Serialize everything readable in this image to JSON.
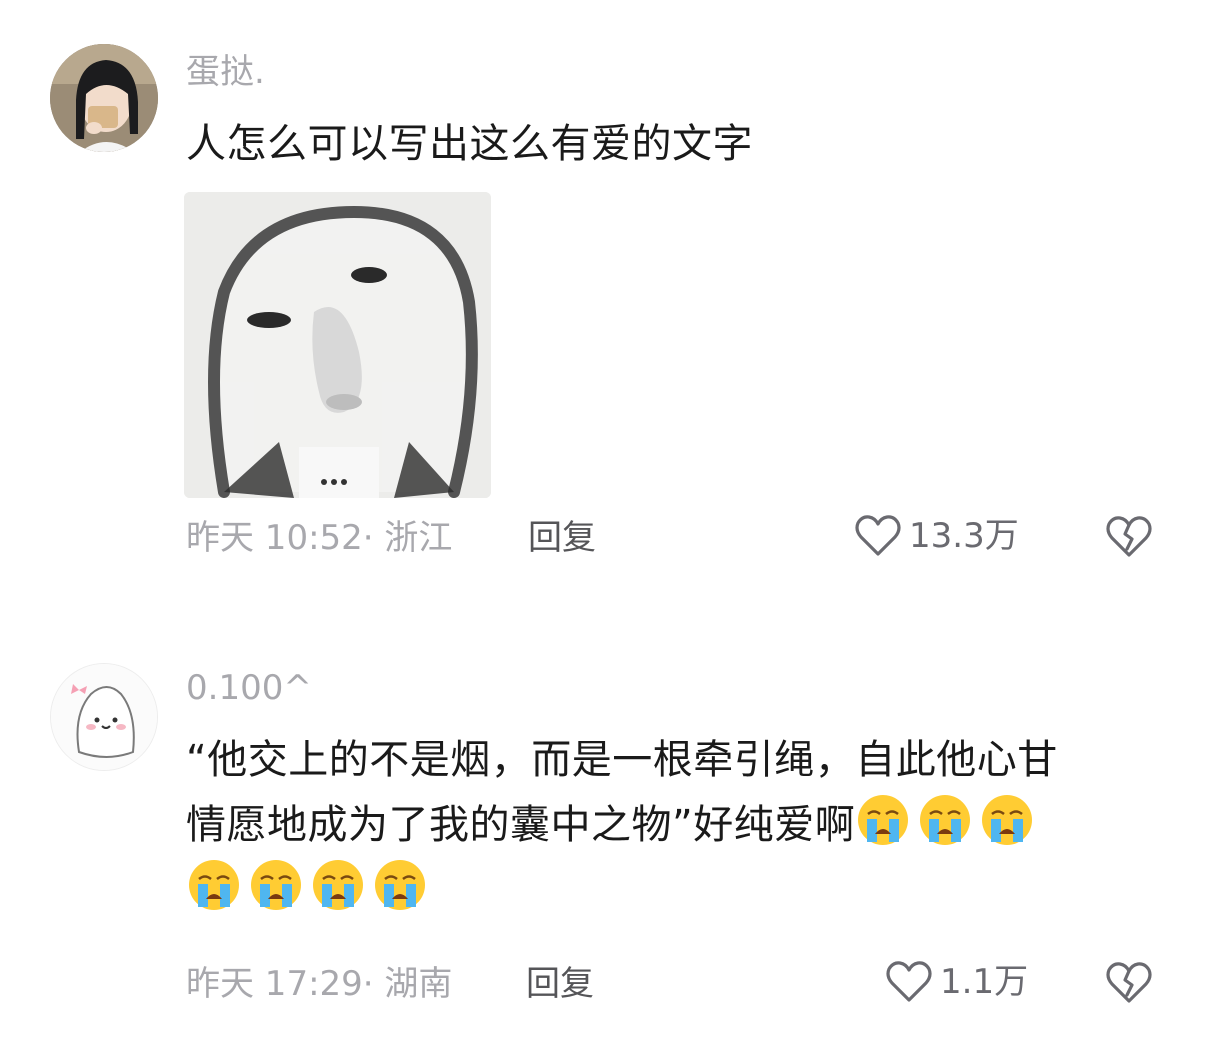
{
  "comments": [
    {
      "username": "蛋挞.",
      "text": "人怎么可以写出这么有爱的文字",
      "time_location": "昨天 10:52· 浙江",
      "reply_label": "回复",
      "likes": "13.3万",
      "has_sticker": true,
      "avatar": "avatar-girl-photo"
    },
    {
      "username": "0.100^",
      "text_line1": "“他交上的不是烟，而是一根牵引绳，自此他心甘",
      "text_line2": "情愿地成为了我的囊中之物”好纯爱啊",
      "emoji_count": 7,
      "emoji": "loudly-crying-face",
      "time_location": "昨天 17:29· 湖南",
      "reply_label": "回复",
      "likes": "1.1万",
      "avatar": "avatar-white-blob"
    }
  ],
  "icons": {
    "like": "heart-outline-icon",
    "dislike": "broken-heart-icon"
  },
  "colors": {
    "text": "#1a1a1a",
    "secondary": "#a8a8ad",
    "reply": "#555558"
  }
}
